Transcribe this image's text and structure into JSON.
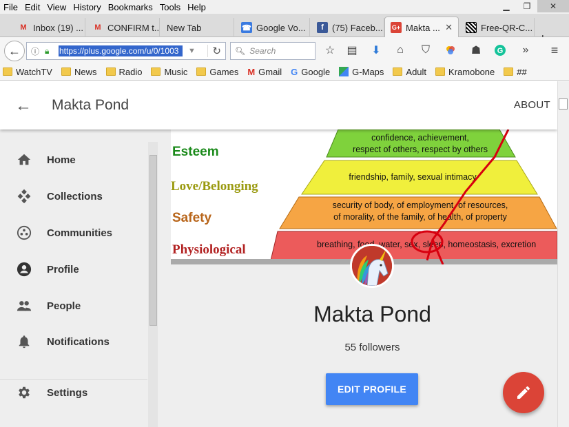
{
  "menubar": {
    "items": [
      "File",
      "Edit",
      "View",
      "History",
      "Bookmarks",
      "Tools",
      "Help"
    ]
  },
  "window_controls": {
    "minimize": "▁",
    "restore": "❐",
    "close": "✕"
  },
  "tabs": [
    {
      "label": "Inbox (19) ...",
      "icon": "gmail-icon",
      "active": false
    },
    {
      "label": "CONFIRM t...",
      "icon": "gmail-icon",
      "active": false
    },
    {
      "label": "New Tab",
      "icon": "",
      "active": false
    },
    {
      "label": "Google Vo...",
      "icon": "google-voice-icon",
      "active": false
    },
    {
      "label": "(75) Faceb...",
      "icon": "facebook-icon",
      "active": false
    },
    {
      "label": "Makta ...",
      "icon": "google-plus-icon",
      "active": true
    },
    {
      "label": "Free-QR-C...",
      "icon": "qr-code-icon",
      "active": false
    }
  ],
  "new_tab_label": "+",
  "url": {
    "value": "https://plus.google.com/u/0/1003"
  },
  "search": {
    "placeholder": "Search"
  },
  "bookmarks": [
    {
      "label": "WatchTV",
      "icon": "folder-icon"
    },
    {
      "label": "News",
      "icon": "folder-icon"
    },
    {
      "label": "Radio",
      "icon": "folder-icon"
    },
    {
      "label": "Music",
      "icon": "folder-icon"
    },
    {
      "label": "Games",
      "icon": "folder-icon"
    },
    {
      "label": "Gmail",
      "icon": "gmail-icon"
    },
    {
      "label": "Google",
      "icon": "google-icon"
    },
    {
      "label": "G-Maps",
      "icon": "maps-icon"
    },
    {
      "label": "Adult",
      "icon": "folder-icon"
    },
    {
      "label": "Kramobone",
      "icon": "folder-icon"
    },
    {
      "label": "##",
      "icon": "folder-icon"
    }
  ],
  "header": {
    "back": "←",
    "title": "Makta Pond",
    "about": "ABOUT"
  },
  "sidebar": {
    "items": [
      {
        "label": "Home",
        "icon": "home-icon"
      },
      {
        "label": "Collections",
        "icon": "collections-icon"
      },
      {
        "label": "Communities",
        "icon": "communities-icon"
      },
      {
        "label": "Profile",
        "icon": "profile-icon"
      },
      {
        "label": "People",
        "icon": "people-icon"
      },
      {
        "label": "Notifications",
        "icon": "notifications-icon"
      },
      {
        "label": "Settings",
        "icon": "settings-icon"
      }
    ]
  },
  "cover": {
    "levels": [
      {
        "label": "Esteem",
        "text1": "confidence, achievement,",
        "text2": "respect of others, respect by others",
        "color": "#7fd23c"
      },
      {
        "label": "Love/Belonging",
        "text1": "friendship, family, sexual intimacy",
        "text2": "",
        "color": "#f0ef3c"
      },
      {
        "label": "Safety",
        "text1": "security of body, of employment, of resources,",
        "text2": "of morality, of the family, of health, of property",
        "color": "#f6a544"
      },
      {
        "label": "Physiological",
        "text1": "breathing, food, water, sex, sleep, homeostasis, excretion",
        "text2": "",
        "color": "#ec5b5b"
      }
    ]
  },
  "profile": {
    "name": "Makta Pond",
    "followers": "55 followers",
    "edit_label": "EDIT PROFILE"
  },
  "colors": {
    "accent": "#4285f4",
    "fab": "#db4437"
  }
}
